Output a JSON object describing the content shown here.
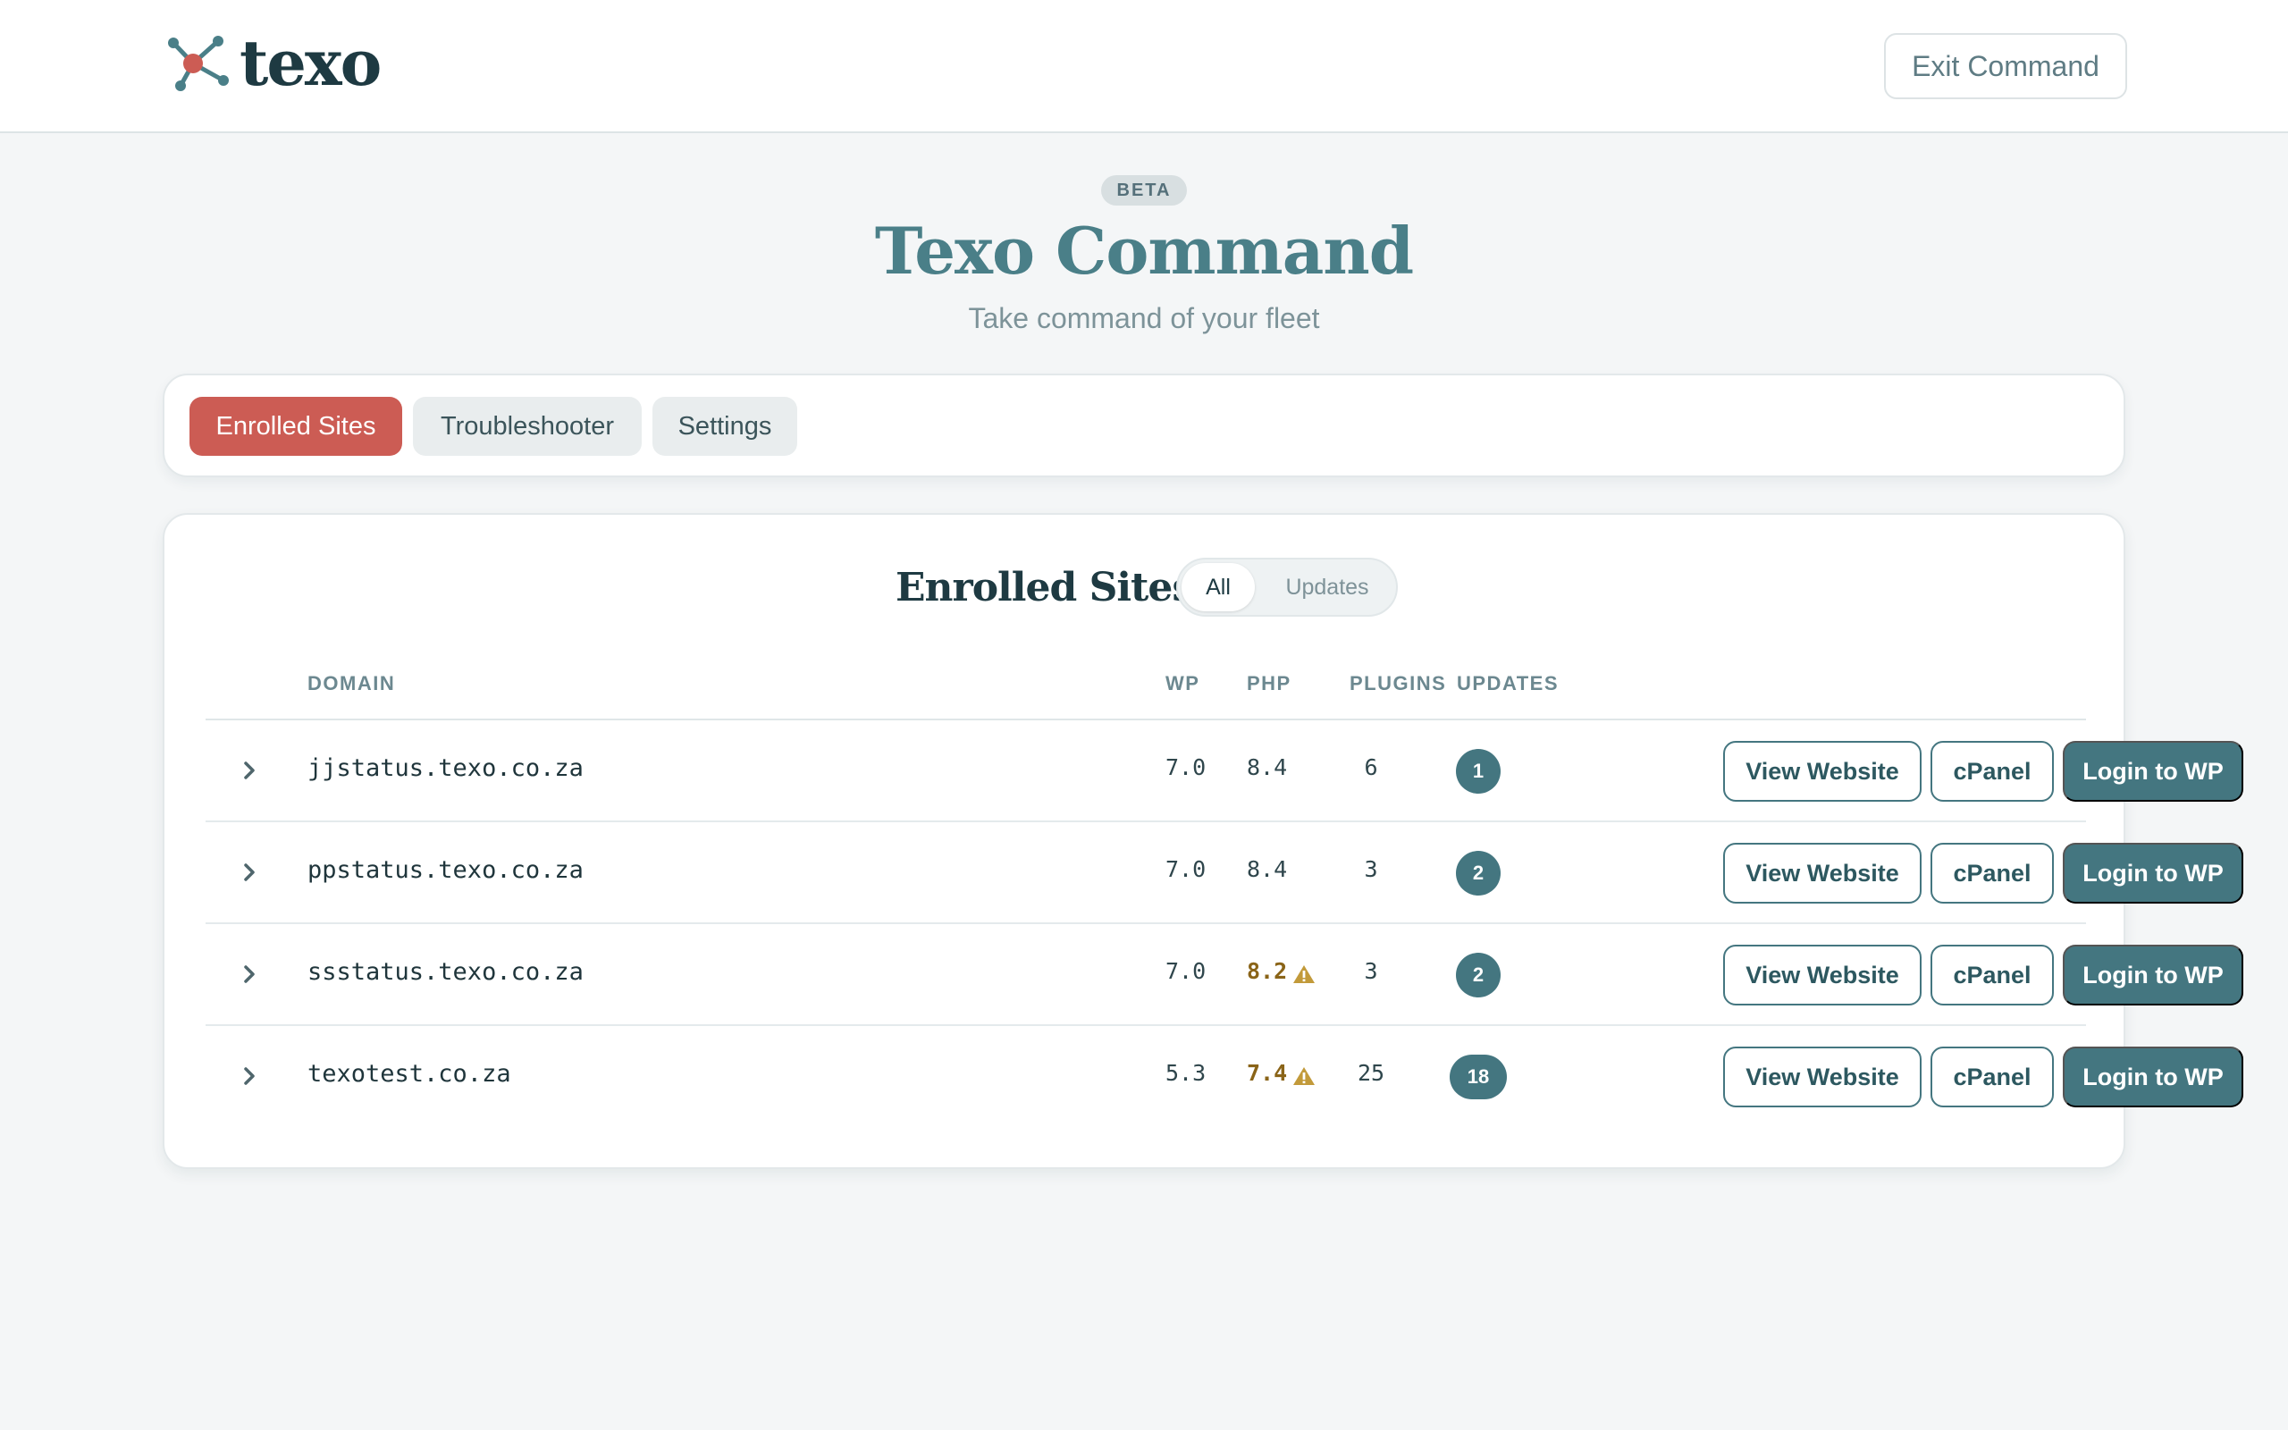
{
  "header": {
    "logo_text": "texo",
    "exit_label": "Exit Command"
  },
  "hero": {
    "badge": "BETA",
    "title": "Texo Command",
    "subtitle": "Take command of your fleet"
  },
  "tabs": [
    {
      "label": "Enrolled Sites",
      "active": true
    },
    {
      "label": "Troubleshooter",
      "active": false
    },
    {
      "label": "Settings",
      "active": false
    }
  ],
  "sites": {
    "title": "Enrolled Sites",
    "filters": [
      {
        "label": "All",
        "active": true
      },
      {
        "label": "Updates",
        "active": false
      }
    ],
    "columns": {
      "domain": "DOMAIN",
      "wp": "WP",
      "php": "PHP",
      "plugins": "PLUGINS",
      "updates": "UPDATES"
    },
    "rows": [
      {
        "domain": "jjstatus.texo.co.za",
        "wp": "7.0",
        "php": "8.4",
        "php_warning": false,
        "plugins": "6",
        "updates": "1",
        "view_label": "View Website",
        "cpanel_label": "cPanel",
        "login_label": "Login to WP"
      },
      {
        "domain": "ppstatus.texo.co.za",
        "wp": "7.0",
        "php": "8.4",
        "php_warning": false,
        "plugins": "3",
        "updates": "2",
        "view_label": "View Website",
        "cpanel_label": "cPanel",
        "login_label": "Login to WP"
      },
      {
        "domain": "ssstatus.texo.co.za",
        "wp": "7.0",
        "php": "8.2",
        "php_warning": true,
        "plugins": "3",
        "updates": "2",
        "view_label": "View Website",
        "cpanel_label": "cPanel",
        "login_label": "Login to WP"
      },
      {
        "domain": "texotest.co.za",
        "wp": "5.3",
        "php": "7.4",
        "php_warning": true,
        "plugins": "25",
        "updates": "18",
        "view_label": "View Website",
        "cpanel_label": "cPanel",
        "login_label": "Login to WP"
      }
    ]
  },
  "colors": {
    "accent_red": "#cc5c54",
    "teal": "#447680",
    "title_teal": "#4a7f88",
    "warning": "#c29a3a"
  },
  "icons": {
    "logo": "network-node-icon",
    "row_expand": "chevron-right-icon",
    "php_warning": "warning-triangle-icon"
  }
}
